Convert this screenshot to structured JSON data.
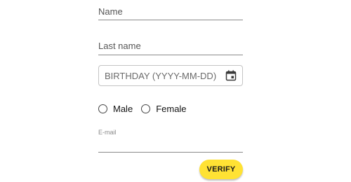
{
  "form": {
    "name_label": "Name",
    "lastname_label": "Last name",
    "birthday": {
      "placeholder": "BIRTHDAY (YYYY-MM-DD)",
      "value": "",
      "icon": "calendar-icon"
    },
    "gender": {
      "options": [
        {
          "label": "Male",
          "checked": false
        },
        {
          "label": "Female",
          "checked": false
        }
      ]
    },
    "email_label": "E-mail",
    "verify_label": "VERIFY"
  },
  "colors": {
    "button_bg": "#ffe234",
    "underline": "#8a8a8a"
  }
}
